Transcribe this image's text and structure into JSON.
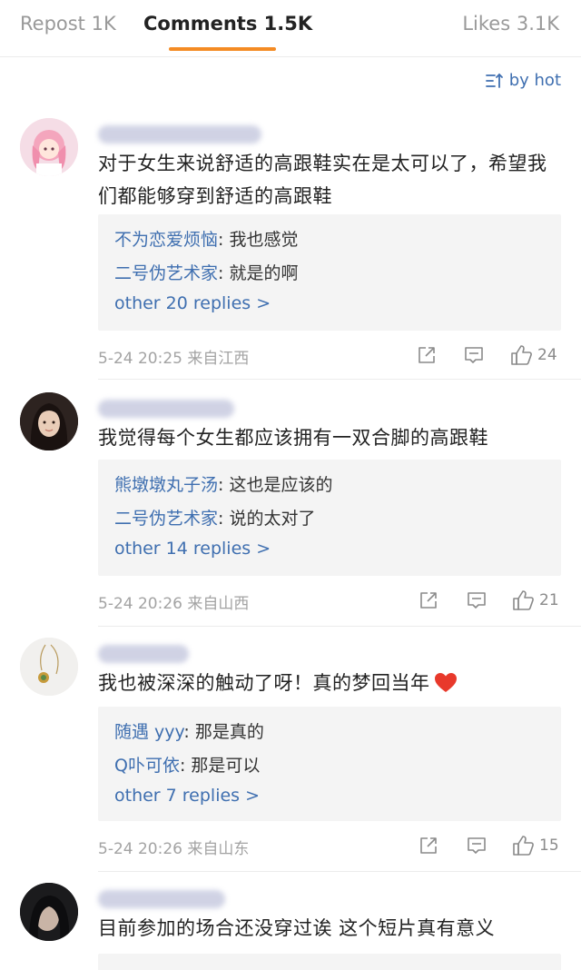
{
  "tabs": [
    {
      "label": "Repost 1K"
    },
    {
      "label": "Comments 1.5K"
    },
    {
      "label": "Likes 3.1K"
    }
  ],
  "sort": {
    "label": "by hot"
  },
  "colors": {
    "accent": "#f48b24",
    "link": "#3f6fb0",
    "heart": "#e8392b"
  },
  "comments": [
    {
      "text": "对于女生来说舒适的高跟鞋实在是太可以了，希望我们都能够穿到舒适的高跟鞋",
      "replies": [
        {
          "name": "不为恋爱烦恼",
          "text": ": 我也感觉"
        },
        {
          "name": "二号伪艺术家",
          "text": ": 就是的啊"
        }
      ],
      "more": "other 20 replies >",
      "meta": "5-24 20:25  来自江西",
      "likes": "24"
    },
    {
      "text": "我觉得每个女生都应该拥有一双合脚的高跟鞋",
      "replies": [
        {
          "name": "熊墩墩丸子汤",
          "text": ": 这也是应该的"
        },
        {
          "name": "二号伪艺术家",
          "text": ": 说的太对了"
        }
      ],
      "more": "other 14 replies >",
      "meta": "5-24 20:26  来自山西",
      "likes": "21"
    },
    {
      "text": "我也被深深的触动了呀！真的梦回当年",
      "emoji": "heart-icon",
      "replies": [
        {
          "name": "随遇 yyy",
          "text": ": 那是真的"
        },
        {
          "name": "Q卟可依",
          "text": ": 那是可以"
        }
      ],
      "more": "other 7 replies >",
      "meta": "5-24 20:26  来自山东",
      "likes": "15"
    },
    {
      "text": "目前参加的场合还没穿过诶 这个短片真有意义"
    }
  ]
}
